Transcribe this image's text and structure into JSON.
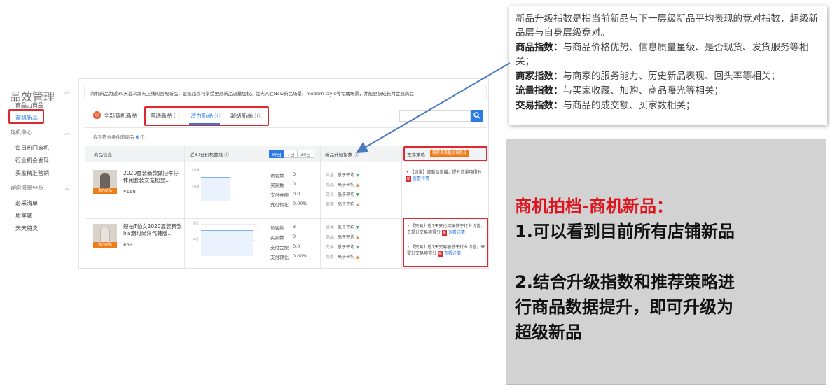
{
  "sidebar": {
    "groups": [
      {
        "label": "品效管理",
        "items": [
          "商品力商品",
          "商机新品"
        ]
      },
      {
        "label": "商机中心",
        "items": [
          "每日热门商机",
          "行业机会发现",
          "买家精准营销"
        ]
      },
      {
        "label": "导购流量分析",
        "items": [
          "必采清单",
          "质享家",
          "天天特卖"
        ]
      }
    ],
    "collapse_icon": "chevron-up-icon"
  },
  "notice": "商机新品为近30天首次发布上线的合规新品，层级越高可享受更高新品流量加权，优先入驻New新品场景、modern style等专属场景，并能更快成长为金冠商品",
  "tabs": {
    "all_label": "全部商机新品",
    "items": [
      "普通新品 ⓘ",
      "潜力新品 ⓘ",
      "超级新品 ⓘ"
    ],
    "active": "潜力新品 ⓘ"
  },
  "search": {
    "placeholder": "",
    "icon": "search-icon"
  },
  "count": {
    "prefix": "找到符合条件的商品",
    "value": "6",
    "suffix": "个"
  },
  "table": {
    "headers": [
      "商品信息",
      "近30日价格曲线 ⓘ",
      "新品升级指数 ⓘ",
      "推荐策略"
    ],
    "periods": [
      "昨日",
      "7日",
      "30日"
    ],
    "active_period": "昨日",
    "strategy_badge": "获更多流量加权机会",
    "stat_labels": [
      "访客数",
      "买家数",
      "支付金额",
      "支付转化"
    ],
    "index_labels": [
      "流量",
      "商品",
      "交易",
      "商家"
    ],
    "rows": [
      {
        "name": "2020夏装新款做旧牛仔休闲套装女宽松显…",
        "price": "¥168",
        "thumb_tag": "潜力新品",
        "y_ticks": [
          "200",
          "100"
        ],
        "stats": [
          "3",
          "0",
          "0.0",
          "0.00%"
        ],
        "indices": [
          {
            "text": "低于平均",
            "dir": "down"
          },
          {
            "text": "高于平均",
            "dir": "up"
          },
          {
            "text": "低于平均",
            "dir": "down"
          },
          {
            "text": "高于平均",
            "dir": "up"
          }
        ],
        "strategies": [
          {
            "text": "【流量】做新品直播，提升流量项得分",
            "badge": "新",
            "link": "查看详情"
          }
        ]
      },
      {
        "name": "短袖T恤女2020夏装新款ins潮时尚洋气韩版…",
        "price": "¥63",
        "thumb_tag": "潜力新品",
        "y_ticks": [
          "80",
          "40"
        ],
        "stats": [
          "3",
          "0",
          "0.0",
          "0.00%"
        ],
        "indices": [
          {
            "text": "低于平均",
            "dir": "down"
          },
          {
            "text": "高于平均",
            "dir": "up"
          },
          {
            "text": "低于平均",
            "dir": "down"
          },
          {
            "text": "高于平均",
            "dir": "up"
          }
        ],
        "strategies": [
          {
            "text": "【交易】近7天支付买家低于行业均值，去提升交易项得分",
            "badge": "新",
            "link": "查看详情"
          },
          {
            "text": "【交易】近7天交易额低于行业均值，去提升交易项得分",
            "badge": "新",
            "link": "查看详情"
          }
        ]
      }
    ]
  },
  "explain": {
    "intro": "新品升级指数是指当前新品与下一层级新品平均表现的竞对指数，超级新品层与自身层级竞对。",
    "items": [
      {
        "term": "商品指数：",
        "desc": "与商品价格优势、信息质量星级、是否现货、发货服务等相关；"
      },
      {
        "term": "商家指数：",
        "desc": "与商家的服务能力、历史新品表现、回头率等相关；"
      },
      {
        "term": "流量指数：",
        "desc": "与买家收藏、加购、商品曝光等相关；"
      },
      {
        "term": "交易指数：",
        "desc": "与商品的成交额、买家数相关；"
      }
    ]
  },
  "callout": {
    "title": "商机拍档-商机新品：",
    "point1": "1.可以看到目前所有店铺新品",
    "point2_line1": "2.结合升级指数和推荐策略进",
    "point2_line2": "行商品数据提升，即可升级为",
    "point2_line3": "超级新品"
  },
  "colors": {
    "accent": "#2c7be5",
    "highlight": "#e0262f",
    "orange": "#f07b19",
    "callout_title": "#e0141e"
  }
}
